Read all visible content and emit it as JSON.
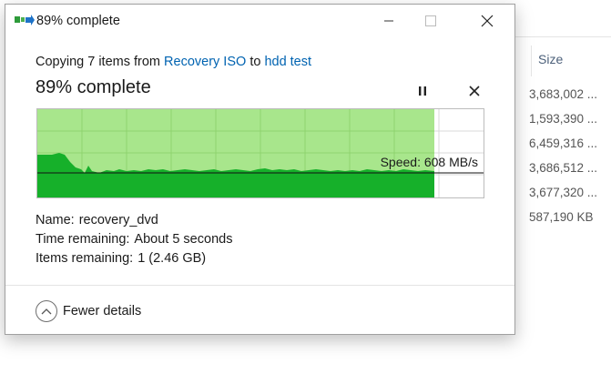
{
  "window": {
    "title": "89% complete"
  },
  "copy_line": {
    "prefix": "Copying 7 items from",
    "source": "Recovery ISO",
    "middle": "to",
    "destination": "hdd test"
  },
  "status": {
    "headline": "89% complete",
    "progress_fraction": 0.89
  },
  "speed": {
    "label": "Speed: 608 MB/s"
  },
  "details": {
    "name_label": "Name:",
    "name_value": "recovery_dvd",
    "time_label": "Time remaining:",
    "time_value": "About 5 seconds",
    "items_label": "Items remaining:",
    "items_value": "1 (2.46 GB)"
  },
  "footer": {
    "fewer_details_label": "Fewer details"
  },
  "background": {
    "size_header": "Size",
    "sizes": [
      "3,683,002 ...",
      "1,593,390 ...",
      "6,459,316 ...",
      "3,686,512 ...",
      "3,677,320 ...",
      "587,190 KB"
    ]
  },
  "colors": {
    "progress_fill": "#a8e68c",
    "speed_fill": "#16b02a",
    "link": "#0063b1"
  }
}
